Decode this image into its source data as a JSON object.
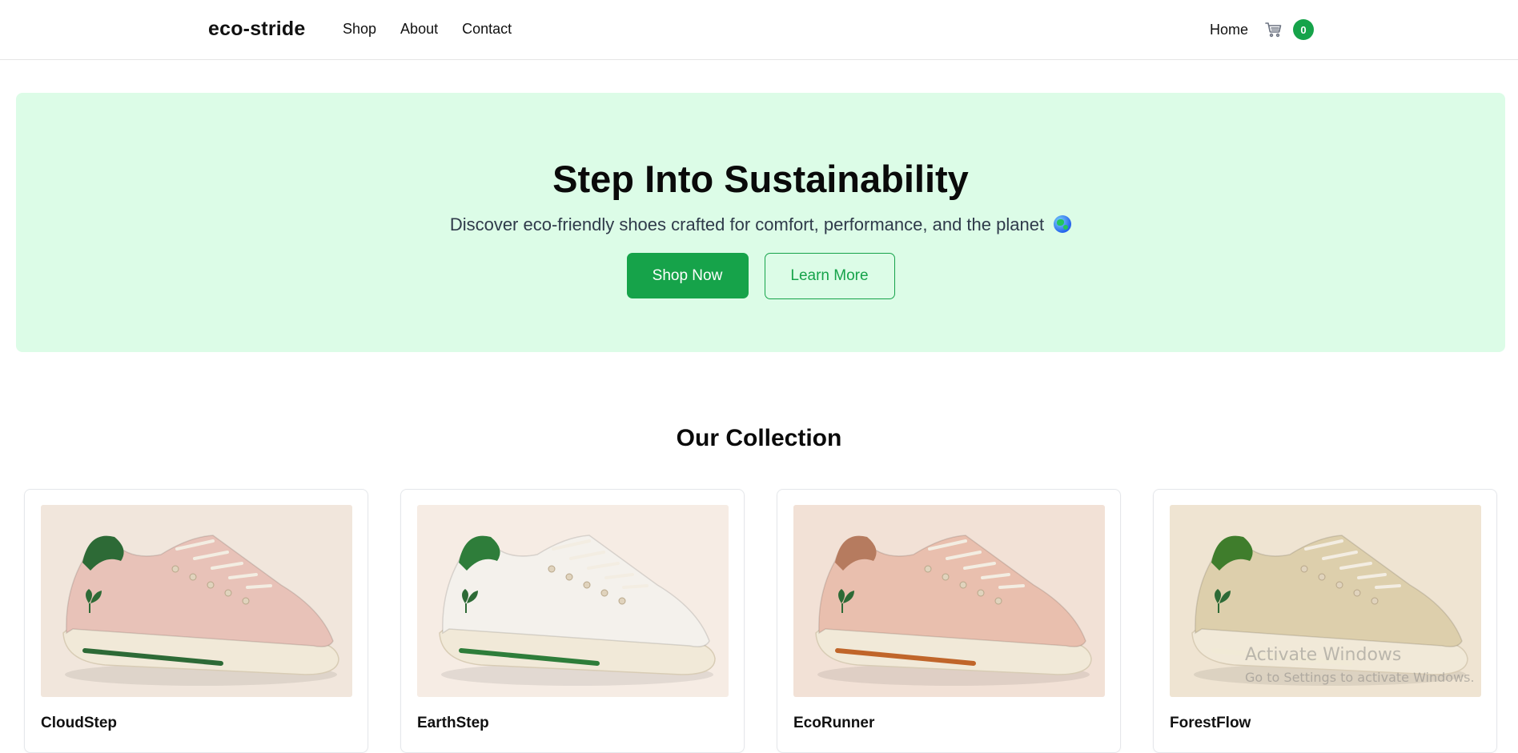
{
  "navbar": {
    "brand": "eco-stride",
    "links": [
      "Shop",
      "About",
      "Contact"
    ],
    "home_label": "Home",
    "cart_icon": "cart-icon",
    "cart_count": "0"
  },
  "hero": {
    "title": "Step Into Sustainability",
    "subtitle": "Discover eco-friendly shoes crafted for comfort, performance, and the planet",
    "subtitle_icon": "globe-icon",
    "primary_button": "Shop Now",
    "secondary_button": "Learn More"
  },
  "collection": {
    "title": "Our Collection",
    "products": [
      {
        "name": "CloudStep",
        "shoe_color": "#e8c2b8",
        "accent": "#2d6a36",
        "stripe": "#2d6a36",
        "bg": "#f1e6dc"
      },
      {
        "name": "EarthStep",
        "shoe_color": "#f4f1ec",
        "accent": "#2e7d3a",
        "stripe": "#2e7d3a",
        "bg": "#f6ece4"
      },
      {
        "name": "EcoRunner",
        "shoe_color": "#e9bfae",
        "accent": "#b67b5f",
        "stripe": "#c0652a",
        "bg": "#f2e1d6"
      },
      {
        "name": "ForestFlow",
        "shoe_color": "#ddcfac",
        "accent": "#3f7d2c",
        "stripe": "#f1ead6",
        "bg": "#efe4d2"
      }
    ]
  },
  "watermark": {
    "title": "Activate Windows",
    "subtitle": "Go to Settings to activate Windows."
  },
  "colors": {
    "accent": "#16a34a",
    "hero_bg": "#dcfce7"
  }
}
